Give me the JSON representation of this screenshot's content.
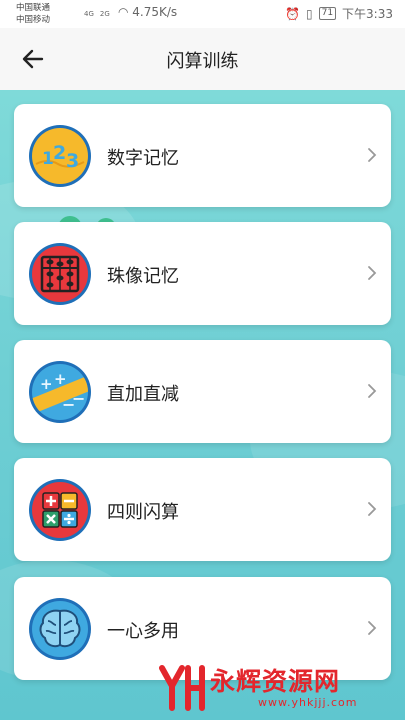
{
  "status_bar": {
    "carrier_1": "中国联通",
    "carrier_2": "中国移动",
    "network_1": "4G",
    "network_2": "2G",
    "speed": "4.75K/s",
    "battery": "71",
    "time": "下午3:33"
  },
  "header": {
    "title": "闪算训练",
    "back_icon": "arrow-left-icon"
  },
  "menu": {
    "items": [
      {
        "label": "数字记忆",
        "icon": "numbers-123-icon"
      },
      {
        "label": "珠像记忆",
        "icon": "abacus-icon"
      },
      {
        "label": "直加直减",
        "icon": "plus-minus-icon"
      },
      {
        "label": "四则闪算",
        "icon": "calculator-operations-icon"
      },
      {
        "label": "一心多用",
        "icon": "brain-icon"
      }
    ]
  },
  "watermark": {
    "text": "永辉资源网",
    "url": "www.yhkjjj.com"
  },
  "colors": {
    "header_bg": "#f7f7f7",
    "background": "#6fcfd4",
    "card_bg": "#ffffff",
    "watermark": "#e3262c"
  }
}
